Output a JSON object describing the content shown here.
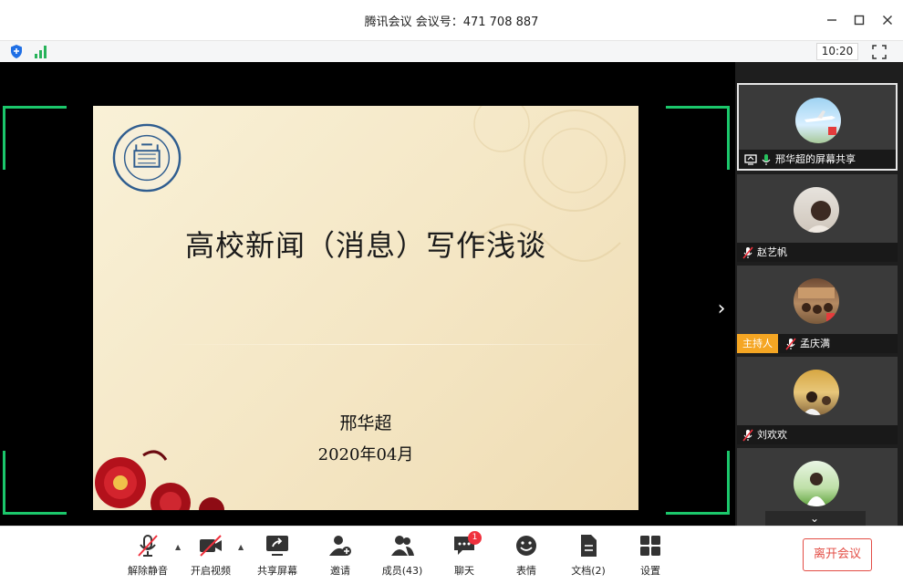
{
  "window": {
    "title": "腾讯会议 会议号：471 708 887",
    "clock": "10:20"
  },
  "slide": {
    "title": "高校新闻（消息）写作浅谈",
    "author": "邢华超",
    "date": "2020年04月"
  },
  "participants": [
    {
      "name": "邢华超的屏幕共享",
      "muted": false,
      "sharing": true,
      "host": false
    },
    {
      "name": "赵艺帆",
      "muted": true,
      "sharing": false,
      "host": false
    },
    {
      "name": "孟庆满",
      "muted": true,
      "sharing": false,
      "host": true
    },
    {
      "name": "刘欢欢",
      "muted": true,
      "sharing": false,
      "host": false
    }
  ],
  "host_label": "主持人",
  "toolbar": {
    "unmute": "解除静音",
    "start_video": "开启视频",
    "share_screen": "共享屏幕",
    "invite": "邀请",
    "members": "成员(43)",
    "chat": "聊天",
    "chat_badge": "1",
    "emoji": "表情",
    "docs": "文档(2)",
    "settings": "设置",
    "leave": "离开会议"
  },
  "colors": {
    "accent_green": "#1bc76b",
    "host_orange": "#f5a623",
    "leave_red": "#e34d45",
    "badge_red": "#f0313d"
  }
}
